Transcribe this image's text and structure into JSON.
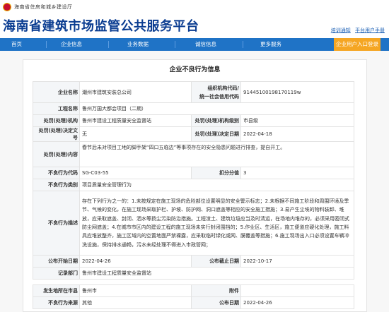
{
  "header": {
    "org_name": "海南省住房和城乡建设厅",
    "platform_title": "海南省建筑市场监管公共服务平台",
    "links": [
      "培训通知",
      "平台用户手册"
    ]
  },
  "nav": {
    "items": [
      "首页",
      "企业信息",
      "业务数据",
      "诚信信息",
      "更多服务"
    ],
    "login": "企业用户入口登录"
  },
  "panel": {
    "title": "企业不良行为信息",
    "fields": {
      "company_name_label": "企业名称",
      "company_name": "潮州市建筑安装总公司",
      "org_code_label_1": "组织机构代码/",
      "org_code_label_2": "统一社会信用代码",
      "org_code": "91445100198170119w",
      "project_label": "工程名称",
      "project": "鲁州万国大都会项目（二期）",
      "handler_label": "处罚(处理)机构",
      "handler": "鲁州市建设工程质量安全监督站",
      "handler_level_label": "处罚(处理)机构级别",
      "handler_level": "市县级",
      "decision_no_label": "处罚(处理)决定文号",
      "decision_no": "无",
      "decision_date_label": "处罚(处理)决定日期",
      "decision_date": "2022-04-18",
      "content_label": "处罚(处理)内容",
      "content": "春节后未对项目工地的脚手架“四口五临边”等事项存在的安全隐患问题进行排查，提自开工。",
      "code_label": "不良行为代码",
      "code": "SG-C03-55",
      "points_label": "扣分分值",
      "points": "3",
      "category_label": "不良行为类别",
      "category": "项目质量安全管理行为",
      "description_label": "不良行为描述",
      "description": "存在下列行为之一的：1.未按规定在施工现场的危险部位设置明显的安全警示标志；2.未根据不同施工阶段和周围环境及季节、气候的变化，在施工现场采取护栏、护坡、防护网、洞口遮盖等相应的安全施工措施；3.易产生尘埃的物料装卸、堆放，应采取遮盖、封闭、洒水等扬尘污染防治措施。工程渣土、建筑垃圾应当及时清运，在场地内堆存的，必须采用密闭式防尘网遮盖；4.在城市市区内的建设工程的施工现场未实行封闭围挡的；5.作业区、生活区，施工便道应硬化处理，施工料具应堆放整齐，施工区域内的空置地面严禁裸露，应采取临时绿化或网、膜覆盖等措施；6.施工现场出入口必须设置车辆冲洗设施，保持排水通畅，污水未经处理不得进入市政管网；",
      "publish_start_label": "公布开始日期",
      "publish_start": "2022-04-26",
      "publish_end_label": "公布截止日期",
      "publish_end": "2022-10-17",
      "recorder_label": "记录部门",
      "recorder": "鲁州市建设工程质量安全监督站",
      "location_label": "发生地所在市县",
      "location": "鲁州市",
      "attachment_label": "附件",
      "attachment": "",
      "source_label": "不良行为来源",
      "source": "其他",
      "published_label": "公布日期",
      "published": "2022-04-26"
    }
  }
}
